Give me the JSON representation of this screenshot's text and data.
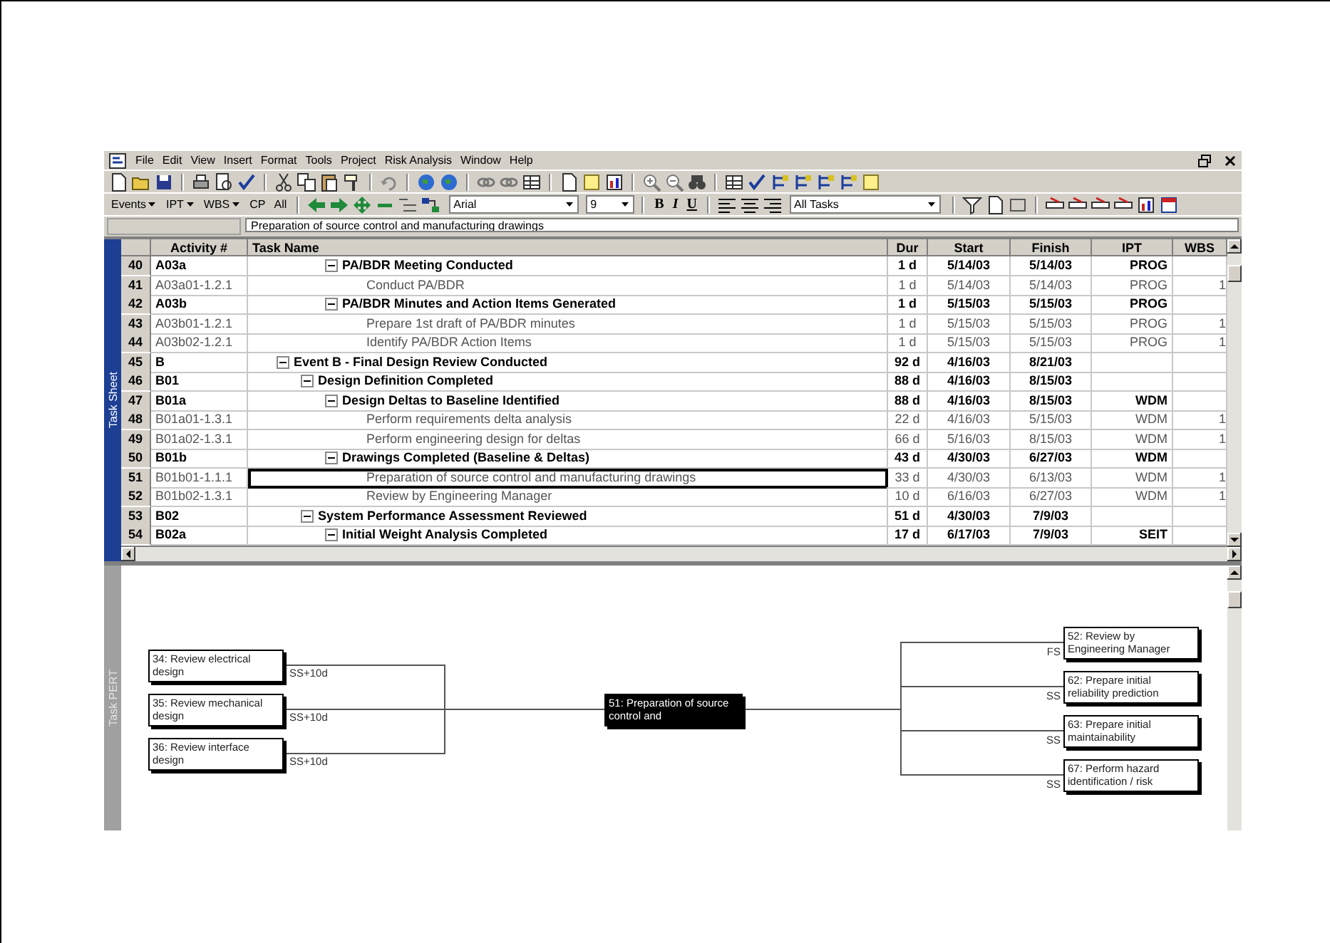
{
  "menu": {
    "items": [
      "File",
      "Edit",
      "View",
      "Insert",
      "Format",
      "Tools",
      "Project",
      "Risk Analysis",
      "Window",
      "Help"
    ]
  },
  "formatting_toolbar": {
    "menus": [
      "Events",
      "IPT",
      "WBS"
    ],
    "buttons": [
      "CP",
      "All"
    ],
    "font": "Arial",
    "size": "9",
    "style_buttons": [
      "B",
      "I",
      "U"
    ],
    "filter": "All Tasks"
  },
  "entry_bar": {
    "value": "Preparation of source control and manufacturing drawings"
  },
  "task_sheet": {
    "label": "Task Sheet"
  },
  "table": {
    "columns": [
      "Activity #",
      "Task Name",
      "Dur",
      "Start",
      "Finish",
      "IPT",
      "WBS"
    ],
    "segments": [
      {
        "kind": "continued",
        "rows": [
          {
            "n": "40",
            "activity": "A03a",
            "name": "PA/BDR Meeting Conducted",
            "dur": "1 d",
            "start": "5/14/03",
            "finish": "5/14/03",
            "ipt": "PROG",
            "summary": true,
            "expanded": true,
            "selected": false,
            "children": [
              {
                "n": "41",
                "activity": "A03a01-1.2.1",
                "name": "Conduct PA/BDR",
                "dur": "1 d",
                "start": "5/14/03",
                "finish": "5/14/03",
                "ipt": "PROG",
                "wbs": "1",
                "summary": false,
                "selected": false
              }
            ]
          },
          {
            "n": "42",
            "activity": "A03b",
            "name": "PA/BDR Minutes  and Action Items Generated",
            "dur": "1 d",
            "start": "5/15/03",
            "finish": "5/15/03",
            "ipt": "PROG",
            "summary": true,
            "expanded": true,
            "selected": false,
            "children": [
              {
                "n": "43",
                "activity": "A03b01-1.2.1",
                "name": "Prepare 1st draft of PA/BDR minutes",
                "dur": "1 d",
                "start": "5/15/03",
                "finish": "5/15/03",
                "ipt": "PROG",
                "wbs": "1",
                "summary": false,
                "selected": false
              },
              {
                "n": "44",
                "activity": "A03b02-1.2.1",
                "name": "Identify PA/BDR Action Items",
                "dur": "1 d",
                "start": "5/15/03",
                "finish": "5/15/03",
                "ipt": "PROG",
                "wbs": "1",
                "summary": false,
                "selected": false
              }
            ]
          }
        ]
      },
      {
        "kind": "root",
        "rows": [
          {
            "n": "45",
            "activity": "B",
            "name": "Event B - Final Design Review Conducted",
            "dur": "92 d",
            "start": "4/16/03",
            "finish": "8/21/03",
            "summary": true,
            "expanded": true,
            "selected": false,
            "children": [
              {
                "n": "46",
                "activity": "B01",
                "name": "Design Definition Completed",
                "dur": "88 d",
                "start": "4/16/03",
                "finish": "8/15/03",
                "summary": true,
                "expanded": true,
                "selected": false,
                "children": [
                  {
                    "n": "47",
                    "activity": "B01a",
                    "name": "Design Deltas to Baseline Identified",
                    "dur": "88 d",
                    "start": "4/16/03",
                    "finish": "8/15/03",
                    "ipt": "WDM",
                    "summary": true,
                    "expanded": true,
                    "selected": false,
                    "children": [
                      {
                        "n": "48",
                        "activity": "B01a01-1.3.1",
                        "name": "Perform requirements delta  analysis",
                        "dur": "22 d",
                        "start": "4/16/03",
                        "finish": "5/15/03",
                        "ipt": "WDM",
                        "wbs": "1",
                        "summary": false,
                        "selected": false
                      },
                      {
                        "n": "49",
                        "activity": "B01a02-1.3.1",
                        "name": "Perform engineering design for deltas",
                        "dur": "66 d",
                        "start": "5/16/03",
                        "finish": "8/15/03",
                        "ipt": "WDM",
                        "wbs": "1",
                        "summary": false,
                        "selected": false
                      }
                    ]
                  },
                  {
                    "n": "50",
                    "activity": "B01b",
                    "name": "Drawings Completed (Baseline & Deltas)",
                    "dur": "43 d",
                    "start": "4/30/03",
                    "finish": "6/27/03",
                    "ipt": "WDM",
                    "summary": true,
                    "expanded": true,
                    "selected": false,
                    "children": [
                      {
                        "n": "51",
                        "activity": "B01b01-1.1.1",
                        "name": "Preparation of source control and manufacturing drawings",
                        "dur": "33 d",
                        "start": "4/30/03",
                        "finish": "6/13/03",
                        "ipt": "WDM",
                        "wbs": "1",
                        "summary": false,
                        "selected": true
                      },
                      {
                        "n": "52",
                        "activity": "B01b02-1.3.1",
                        "name": "Review by Engineering Manager",
                        "dur": "10 d",
                        "start": "6/16/03",
                        "finish": "6/27/03",
                        "ipt": "WDM",
                        "wbs": "1",
                        "summary": false,
                        "selected": false
                      }
                    ]
                  }
                ]
              },
              {
                "n": "53",
                "activity": "B02",
                "name": "System Performance Assessment Reviewed",
                "dur": "51 d",
                "start": "4/30/03",
                "finish": "7/9/03",
                "summary": true,
                "expanded": true,
                "selected": false,
                "children": [
                  {
                    "n": "54",
                    "activity": "B02a",
                    "name": "Initial Weight Analysis Completed",
                    "dur": "17 d",
                    "start": "6/17/03",
                    "finish": "7/9/03",
                    "ipt": "SEIT",
                    "summary": true,
                    "expanded": true,
                    "selected": false
                  }
                ]
              }
            ]
          }
        ]
      }
    ]
  },
  "task_pert": {
    "label": "Task PERT"
  },
  "network": {
    "predecessors": [
      {
        "label": "34: Review electrical design",
        "link": "SS+10d"
      },
      {
        "label": "35: Review mechanical design",
        "link": "SS+10d"
      },
      {
        "label": "36: Review interface design",
        "link": "SS+10d"
      }
    ],
    "task": {
      "label": "51: Preparation of source control and"
    },
    "successors": [
      {
        "label": "52: Review by Engineering Manager",
        "link": "FS"
      },
      {
        "label": "62: Prepare initial reliability prediction",
        "link": "SS"
      },
      {
        "label": "63: Prepare initial maintainability",
        "link": "SS"
      },
      {
        "label": "67: Perform hazard identification / risk",
        "link": "SS"
      }
    ]
  }
}
